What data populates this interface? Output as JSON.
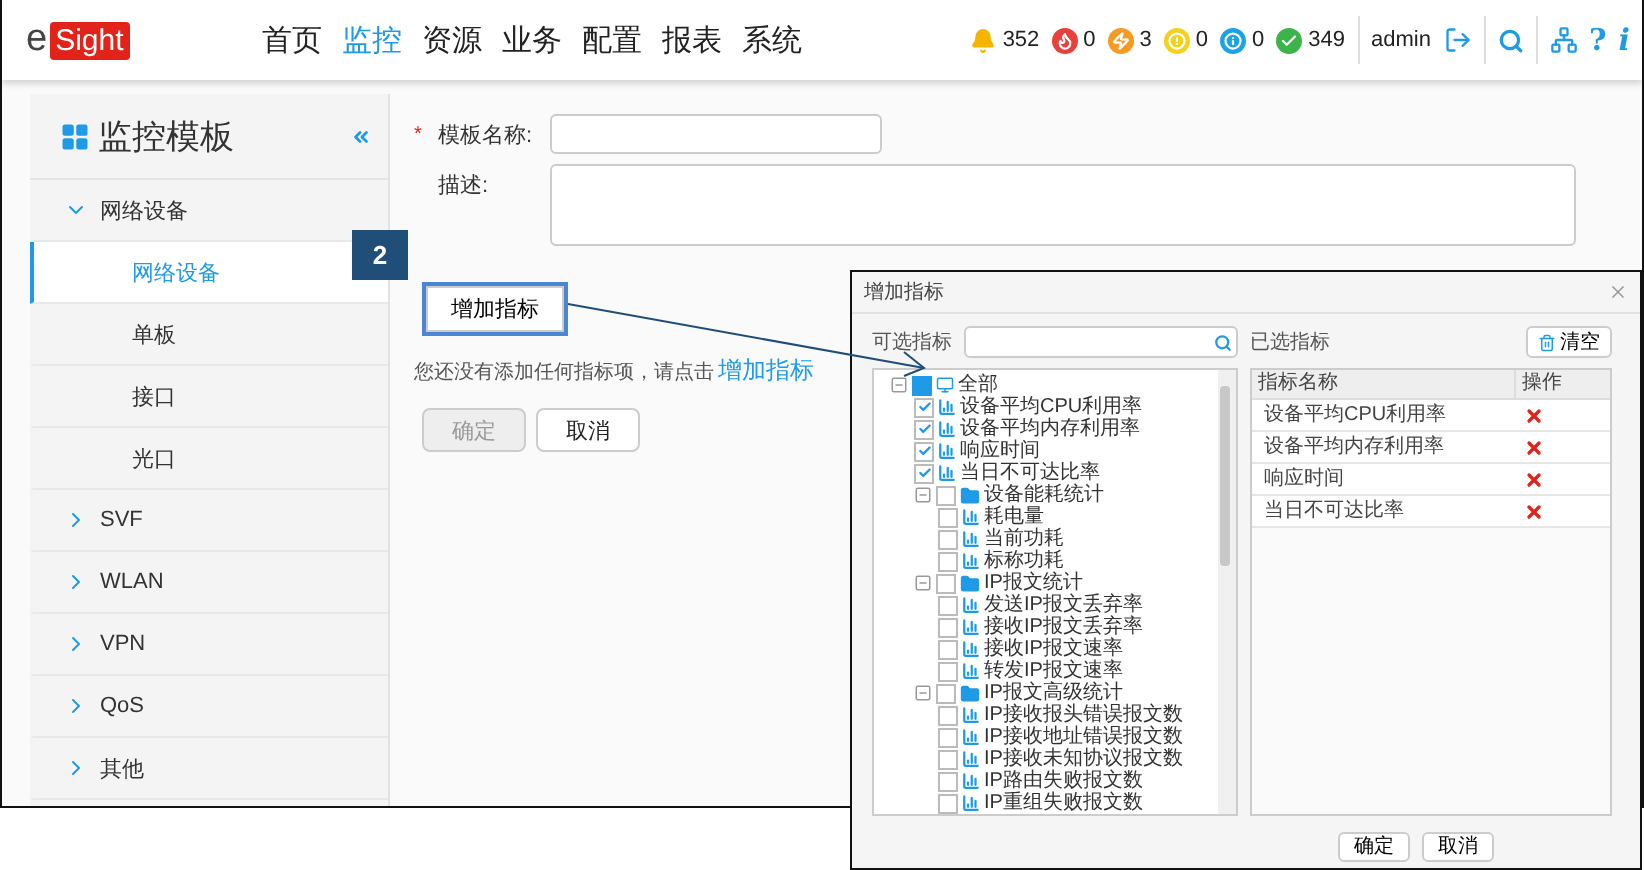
{
  "header": {
    "logo_prefix": "e",
    "logo_box": "Sight",
    "nav": [
      {
        "label": "首页",
        "selected": false
      },
      {
        "label": "监控",
        "selected": true
      },
      {
        "label": "资源",
        "selected": false
      },
      {
        "label": "业务",
        "selected": false
      },
      {
        "label": "配置",
        "selected": false
      },
      {
        "label": "报表",
        "selected": false
      },
      {
        "label": "系统",
        "selected": false
      }
    ],
    "alarms": [
      {
        "kind": "bell",
        "color": "#f5b400",
        "count": "352"
      },
      {
        "kind": "flame",
        "color": "#e8413c",
        "count": "0"
      },
      {
        "kind": "bolt",
        "color": "#f59a23",
        "count": "3"
      },
      {
        "kind": "alert",
        "color": "#f2d21b",
        "count": "0"
      },
      {
        "kind": "info",
        "color": "#1aa3e8",
        "count": "0"
      },
      {
        "kind": "ok",
        "color": "#3cb44a",
        "count": "349"
      }
    ],
    "user": "admin",
    "help": "?",
    "info": "i"
  },
  "sidebar": {
    "title": "监控模板",
    "groups": [
      {
        "label": "网络设备",
        "expanded": true,
        "children": [
          {
            "label": "网络设备",
            "selected": true
          },
          {
            "label": "单板",
            "selected": false
          },
          {
            "label": "接口",
            "selected": false
          },
          {
            "label": "光口",
            "selected": false
          }
        ]
      },
      {
        "label": "SVF",
        "expanded": false
      },
      {
        "label": "WLAN",
        "expanded": false
      },
      {
        "label": "VPN",
        "expanded": false
      },
      {
        "label": "QoS",
        "expanded": false
      },
      {
        "label": "其他",
        "expanded": false
      }
    ]
  },
  "form": {
    "name_required": "*",
    "name_label": "模板名称:",
    "desc_label": "描述:",
    "add_button": "增加指标",
    "hint": "您还没有添加任何指标项，请点击",
    "hint_link": "增加指标",
    "ok_button": "确定",
    "ok_disabled": true,
    "cancel_button": "取消"
  },
  "callout": {
    "step": "2"
  },
  "dialog": {
    "title": "增加指标",
    "left_label": "可选指标",
    "right_label": "已选指标",
    "clear_button": "清空",
    "tree": [
      {
        "label": "全部",
        "kind": "root",
        "checked": false,
        "partial": true,
        "expanded": true,
        "children": [
          {
            "label": "设备平均CPU利用率",
            "kind": "metric",
            "checked": true
          },
          {
            "label": "设备平均内存利用率",
            "kind": "metric",
            "checked": true
          },
          {
            "label": "响应时间",
            "kind": "metric",
            "checked": true
          },
          {
            "label": "当日不可达比率",
            "kind": "metric",
            "checked": true
          },
          {
            "label": "设备能耗统计",
            "kind": "folder",
            "checked": false,
            "expanded": true,
            "children": [
              {
                "label": "耗电量",
                "kind": "metric",
                "checked": false
              },
              {
                "label": "当前功耗",
                "kind": "metric",
                "checked": false
              },
              {
                "label": "标称功耗",
                "kind": "metric",
                "checked": false
              }
            ]
          },
          {
            "label": "IP报文统计",
            "kind": "folder",
            "checked": false,
            "expanded": true,
            "children": [
              {
                "label": "发送IP报文丢弃率",
                "kind": "metric",
                "checked": false
              },
              {
                "label": "接收IP报文丢弃率",
                "kind": "metric",
                "checked": false
              },
              {
                "label": "接收IP报文速率",
                "kind": "metric",
                "checked": false
              },
              {
                "label": "转发IP报文速率",
                "kind": "metric",
                "checked": false
              }
            ]
          },
          {
            "label": "IP报文高级统计",
            "kind": "folder",
            "checked": false,
            "expanded": true,
            "children": [
              {
                "label": "IP接收报头错误报文数",
                "kind": "metric",
                "checked": false
              },
              {
                "label": "IP接收地址错误报文数",
                "kind": "metric",
                "checked": false
              },
              {
                "label": "IP接收未知协议报文数",
                "kind": "metric",
                "checked": false
              },
              {
                "label": "IP路由失败报文数",
                "kind": "metric",
                "checked": false
              },
              {
                "label": "IP重组失败报文数",
                "kind": "metric",
                "checked": false
              }
            ]
          }
        ]
      }
    ],
    "columns": [
      "指标名称",
      "操作"
    ],
    "rows": [
      {
        "name": "设备平均CPU利用率"
      },
      {
        "name": "设备平均内存利用率"
      },
      {
        "name": "响应时间"
      },
      {
        "name": "当日不可达比率"
      }
    ],
    "ok_button": "确定",
    "cancel_button": "取消"
  }
}
